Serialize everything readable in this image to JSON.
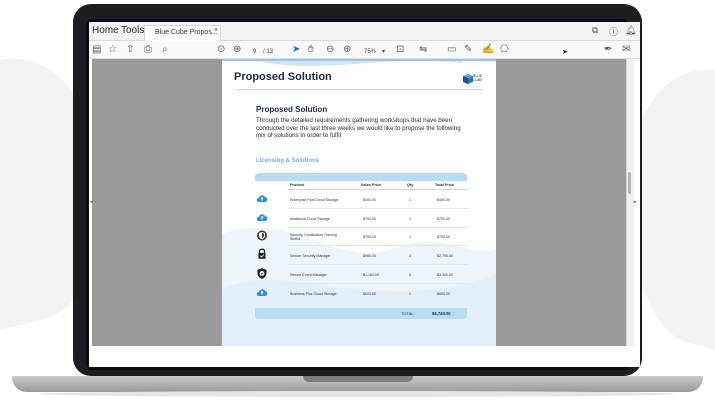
{
  "menubar": {
    "home": "Home",
    "tools": "Tools",
    "tab_title": "Blue Cube Propos...",
    "tab_close": "×"
  },
  "toolbar": {
    "page_current": "9",
    "page_sep": "/ 13",
    "zoom": "75%"
  },
  "page": {
    "header_title": "Proposed Solution",
    "logo_text_line1": "BLUE",
    "logo_text_line2": "CUBE",
    "section_title": "Proposed Solution",
    "intro_text": "Through the detailed requirements gathering workshops that have been conducted over the last three weeks we would like to propose the following mix of solutions in order to fulfil",
    "licensing_title": "Licensing & Solutions",
    "table": {
      "headers": [
        "Product",
        "Sales Price",
        "Qty",
        "Total Price"
      ],
      "rows": [
        {
          "product": "Enterprise Plus Cloud Storage",
          "price": "$400.00",
          "qty": "1",
          "total": "$400.00",
          "icon": "cloud-upload-icon"
        },
        {
          "product": "Additional Cloud Storage",
          "price": "$700.00",
          "qty": "1",
          "total": "$700.00",
          "icon": "cloud-upload-icon"
        },
        {
          "product": "Security Certification Training Sheild",
          "price": "$799.00",
          "qty": "1",
          "total": "$799.00",
          "icon": "shield-badge-icon"
        },
        {
          "product": "Secure Security Manager",
          "price": "$900.00",
          "qty": "3",
          "total": "$2,700.00",
          "icon": "padlock-icon"
        },
        {
          "product": "Secure Event Manager",
          "price": "$1,100.00",
          "qty": "3",
          "total": "$3,300.00",
          "icon": "shield-check-icon"
        },
        {
          "product": "Business Plus Cloud Storage",
          "price": "$600.00",
          "qty": "1",
          "total": "$600.00",
          "icon": "cloud-upload-icon"
        }
      ],
      "total_label": "TOTAL:",
      "total_value": "$5,749.00"
    }
  },
  "colors": {
    "accent": "#1473e6",
    "table_band": "#b9dcf3",
    "heading": "#1b2a4a",
    "viewer_gray": "#9a9a9a"
  }
}
